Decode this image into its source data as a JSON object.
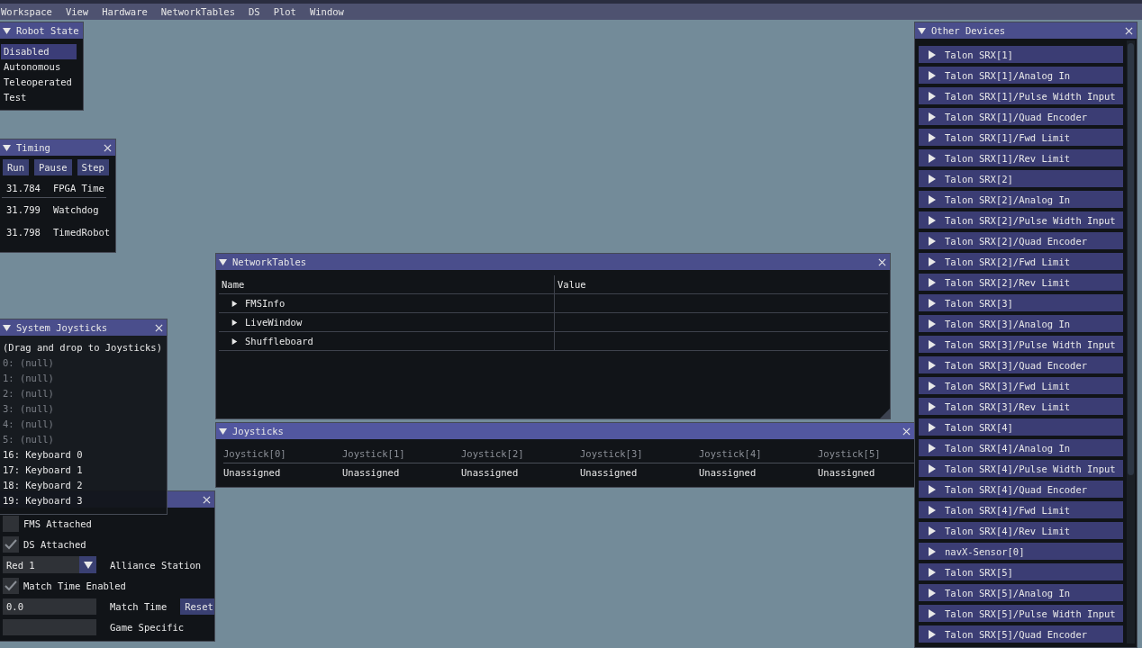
{
  "menu": [
    "Workspace",
    "View",
    "Hardware",
    "NetworkTables",
    "DS",
    "Plot",
    "Window"
  ],
  "robot_state": {
    "title": "Robot State",
    "modes": [
      {
        "label": "Disabled",
        "selected": true
      },
      {
        "label": "Autonomous",
        "selected": false
      },
      {
        "label": "Teleoperated",
        "selected": false
      },
      {
        "label": "Test",
        "selected": false
      }
    ]
  },
  "timing": {
    "title": "Timing",
    "buttons": [
      "Run",
      "Pause",
      "Step"
    ],
    "rows": [
      {
        "value": "31.784",
        "label": "FPGA Time"
      },
      {
        "value": "31.799",
        "label": "Watchdog"
      },
      {
        "value": "31.798",
        "label": "TimedRobot"
      }
    ]
  },
  "network_tables": {
    "title": "NetworkTables",
    "columns": [
      "Name",
      "Value"
    ],
    "rows": [
      {
        "name": "FMSInfo",
        "expanded": false
      },
      {
        "name": "LiveWindow",
        "expanded": false
      },
      {
        "name": "Shuffleboard",
        "expanded": false
      }
    ]
  },
  "system_joysticks": {
    "title": "System Joysticks",
    "hint": "(Drag and drop to Joysticks)",
    "items": [
      {
        "label": "0: (null)",
        "disabled": true
      },
      {
        "label": "1: (null)",
        "disabled": true
      },
      {
        "label": "2: (null)",
        "disabled": true
      },
      {
        "label": "3: (null)",
        "disabled": true
      },
      {
        "label": "4: (null)",
        "disabled": true
      },
      {
        "label": "5: (null)",
        "disabled": true
      },
      {
        "label": "16: Keyboard 0",
        "disabled": false
      },
      {
        "label": "17: Keyboard 1",
        "disabled": false
      },
      {
        "label": "18: Keyboard 2",
        "disabled": false
      },
      {
        "label": "19: Keyboard 3",
        "disabled": false
      }
    ]
  },
  "fms": {
    "rows": [
      {
        "kind": "checkbox",
        "label": "FMS Attached",
        "checked": false
      },
      {
        "kind": "checkbox",
        "label": "DS Attached",
        "checked": true
      },
      {
        "kind": "select",
        "label": "Alliance Station",
        "field": {
          "value": "Red 1"
        }
      },
      {
        "kind": "checkbox",
        "label": "Match Time Enabled",
        "checked": true
      },
      {
        "kind": "input",
        "label": "Match Time",
        "field": {
          "value": "0.0"
        },
        "button": "Reset"
      },
      {
        "kind": "input",
        "label": "Game Specific"
      }
    ]
  },
  "joysticks": {
    "title": "Joysticks",
    "columns": [
      {
        "header": "Joystick[0]",
        "value": "Unassigned"
      },
      {
        "header": "Joystick[1]",
        "value": "Unassigned"
      },
      {
        "header": "Joystick[2]",
        "value": "Unassigned"
      },
      {
        "header": "Joystick[3]",
        "value": "Unassigned"
      },
      {
        "header": "Joystick[4]",
        "value": "Unassigned"
      },
      {
        "header": "Joystick[5]",
        "value": "Unassigned"
      }
    ]
  },
  "other_devices": {
    "title": "Other Devices",
    "items": [
      {
        "label": "Talon SRX[1]",
        "expanded": false
      },
      {
        "label": "Talon SRX[1]/Analog In",
        "expanded": false
      },
      {
        "label": "Talon SRX[1]/Pulse Width Input",
        "expanded": false
      },
      {
        "label": "Talon SRX[1]/Quad Encoder",
        "expanded": false
      },
      {
        "label": "Talon SRX[1]/Fwd Limit",
        "expanded": false
      },
      {
        "label": "Talon SRX[1]/Rev Limit",
        "expanded": false
      },
      {
        "label": "Talon SRX[2]",
        "expanded": false
      },
      {
        "label": "Talon SRX[2]/Analog In",
        "expanded": false
      },
      {
        "label": "Talon SRX[2]/Pulse Width Input",
        "expanded": false
      },
      {
        "label": "Talon SRX[2]/Quad Encoder",
        "expanded": false
      },
      {
        "label": "Talon SRX[2]/Fwd Limit",
        "expanded": false
      },
      {
        "label": "Talon SRX[2]/Rev Limit",
        "expanded": false
      },
      {
        "label": "Talon SRX[3]",
        "expanded": false
      },
      {
        "label": "Talon SRX[3]/Analog In",
        "expanded": false
      },
      {
        "label": "Talon SRX[3]/Pulse Width Input",
        "expanded": false
      },
      {
        "label": "Talon SRX[3]/Quad Encoder",
        "expanded": false
      },
      {
        "label": "Talon SRX[3]/Fwd Limit",
        "expanded": false
      },
      {
        "label": "Talon SRX[3]/Rev Limit",
        "expanded": false
      },
      {
        "label": "Talon SRX[4]",
        "expanded": false
      },
      {
        "label": "Talon SRX[4]/Analog In",
        "expanded": false
      },
      {
        "label": "Talon SRX[4]/Pulse Width Input",
        "expanded": false
      },
      {
        "label": "Talon SRX[4]/Quad Encoder",
        "expanded": false
      },
      {
        "label": "Talon SRX[4]/Fwd Limit",
        "expanded": false
      },
      {
        "label": "Talon SRX[4]/Rev Limit",
        "expanded": false
      },
      {
        "label": "navX-Sensor[0]",
        "expanded": false
      },
      {
        "label": "Talon SRX[5]",
        "expanded": false
      },
      {
        "label": "Talon SRX[5]/Analog In",
        "expanded": false
      },
      {
        "label": "Talon SRX[5]/Pulse Width Input",
        "expanded": false
      },
      {
        "label": "Talon SRX[5]/Quad Encoder",
        "expanded": false
      }
    ]
  }
}
